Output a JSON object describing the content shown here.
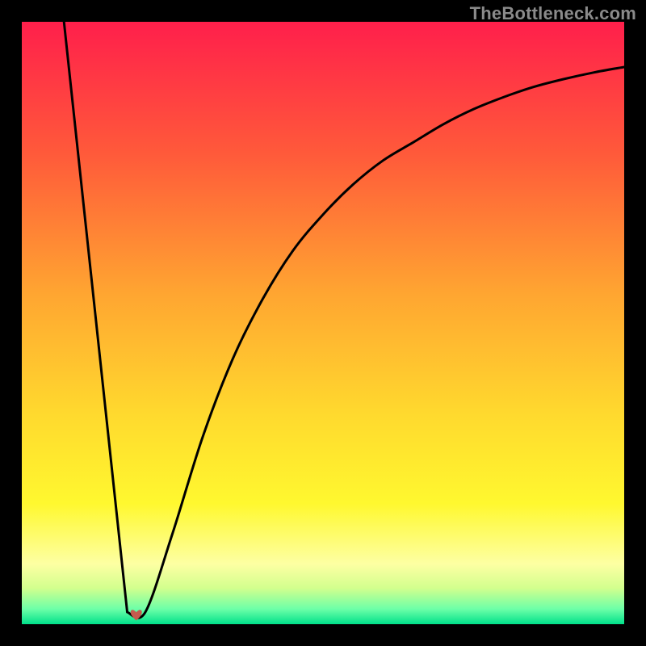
{
  "watermark": "TheBottleneck.com",
  "chart_data": {
    "type": "line",
    "title": "",
    "xlabel": "",
    "ylabel": "",
    "xlim": [
      0,
      100
    ],
    "ylim": [
      0,
      100
    ],
    "background_gradient_stops": [
      {
        "pos": 0.0,
        "color": "#ff1f4b"
      },
      {
        "pos": 0.22,
        "color": "#ff5a3a"
      },
      {
        "pos": 0.45,
        "color": "#ffa531"
      },
      {
        "pos": 0.65,
        "color": "#ffd92e"
      },
      {
        "pos": 0.8,
        "color": "#fff82f"
      },
      {
        "pos": 0.9,
        "color": "#fdffa3"
      },
      {
        "pos": 0.94,
        "color": "#d3ff8e"
      },
      {
        "pos": 0.975,
        "color": "#6cffa8"
      },
      {
        "pos": 1.0,
        "color": "#00e08a"
      }
    ],
    "curve_color": "#000000",
    "curve_stroke_width": 3,
    "series": [
      {
        "name": "bottleneck-curve",
        "type": "line",
        "segments": [
          {
            "kind": "line",
            "x": [
              7.0,
              17.5
            ],
            "y": [
              100.0,
              2.0
            ]
          },
          {
            "kind": "curve",
            "x": [
              17.5,
              20.5,
              25,
              30,
              35,
              40,
              45,
              50,
              55,
              60,
              65,
              70,
              75,
              80,
              85,
              90,
              95,
              100
            ],
            "y": [
              2.0,
              2.0,
              15,
              31,
              44,
              54,
              62,
              68,
              73,
              77,
              80,
              83,
              85.5,
              87.5,
              89.2,
              90.5,
              91.6,
              92.5
            ]
          }
        ]
      }
    ],
    "markers": [
      {
        "name": "min-heart",
        "x": 19.0,
        "y": 1.5,
        "color": "#c55a4e",
        "size": 18
      }
    ]
  }
}
